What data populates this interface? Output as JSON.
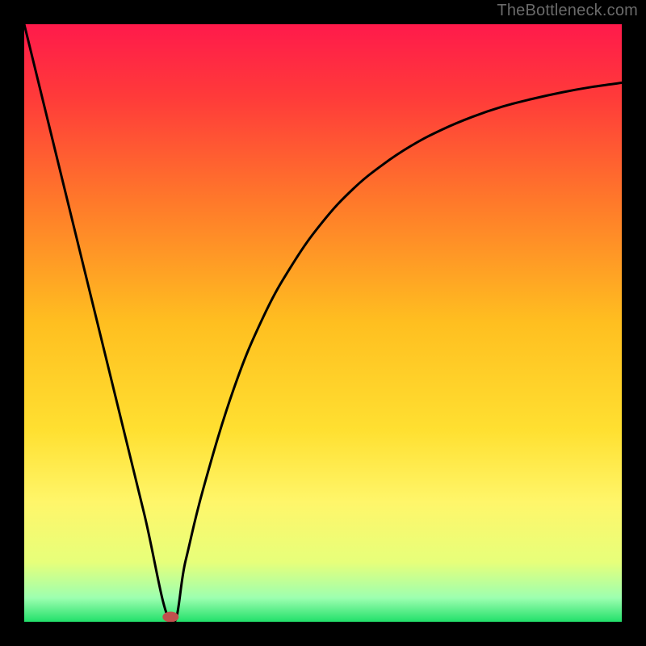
{
  "watermark": "TheBottleneck.com",
  "chart_data": {
    "type": "line",
    "title": "",
    "xlabel": "",
    "ylabel": "",
    "xlim": [
      0,
      1
    ],
    "ylim": [
      0,
      1
    ],
    "x_minimum": 0.245,
    "series": [
      {
        "name": "curve",
        "x": [
          0.0,
          0.05,
          0.1,
          0.15,
          0.2,
          0.245,
          0.27,
          0.3,
          0.35,
          0.4,
          0.45,
          0.5,
          0.55,
          0.6,
          0.65,
          0.7,
          0.75,
          0.8,
          0.85,
          0.9,
          0.95,
          1.0
        ],
        "y": [
          1.0,
          0.796,
          0.592,
          0.388,
          0.184,
          0.0,
          0.102,
          0.224,
          0.388,
          0.51,
          0.6,
          0.67,
          0.724,
          0.765,
          0.798,
          0.824,
          0.845,
          0.862,
          0.875,
          0.886,
          0.895,
          0.902
        ]
      }
    ],
    "marker": {
      "x": 0.245,
      "y": 0.0,
      "color": "#c0504d"
    },
    "gradient_stops": [
      {
        "offset": 0.0,
        "color": "#ff1a4b"
      },
      {
        "offset": 0.12,
        "color": "#ff3a3a"
      },
      {
        "offset": 0.3,
        "color": "#ff7a2a"
      },
      {
        "offset": 0.5,
        "color": "#ffbf20"
      },
      {
        "offset": 0.68,
        "color": "#ffe031"
      },
      {
        "offset": 0.8,
        "color": "#fff66a"
      },
      {
        "offset": 0.9,
        "color": "#e7ff7a"
      },
      {
        "offset": 0.96,
        "color": "#9dffb0"
      },
      {
        "offset": 1.0,
        "color": "#22e06a"
      }
    ]
  }
}
